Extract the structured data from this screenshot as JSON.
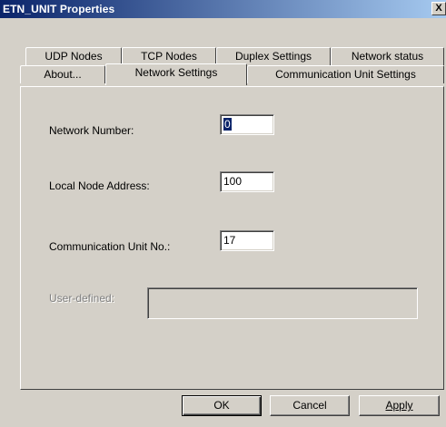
{
  "window": {
    "title": "ETN_UNIT Properties",
    "close_label": "X"
  },
  "tabs": {
    "row_back": [
      {
        "label": "UDP Nodes"
      },
      {
        "label": "TCP Nodes"
      },
      {
        "label": "Duplex Settings"
      },
      {
        "label": "Network status"
      }
    ],
    "row_front": [
      {
        "label": "About..."
      },
      {
        "label": "Network Settings",
        "active": true
      },
      {
        "label": "Communication Unit Settings"
      }
    ]
  },
  "form": {
    "network_number": {
      "label": "Network Number:",
      "value": "0"
    },
    "local_node_address": {
      "label": "Local Node Address:",
      "value": "100"
    },
    "communication_unit_no": {
      "label": "Communication Unit No.:",
      "value": "17"
    },
    "user_defined": {
      "label": "User-defined:",
      "value": ""
    }
  },
  "buttons": {
    "ok": "OK",
    "cancel": "Cancel",
    "apply": "Apply"
  }
}
